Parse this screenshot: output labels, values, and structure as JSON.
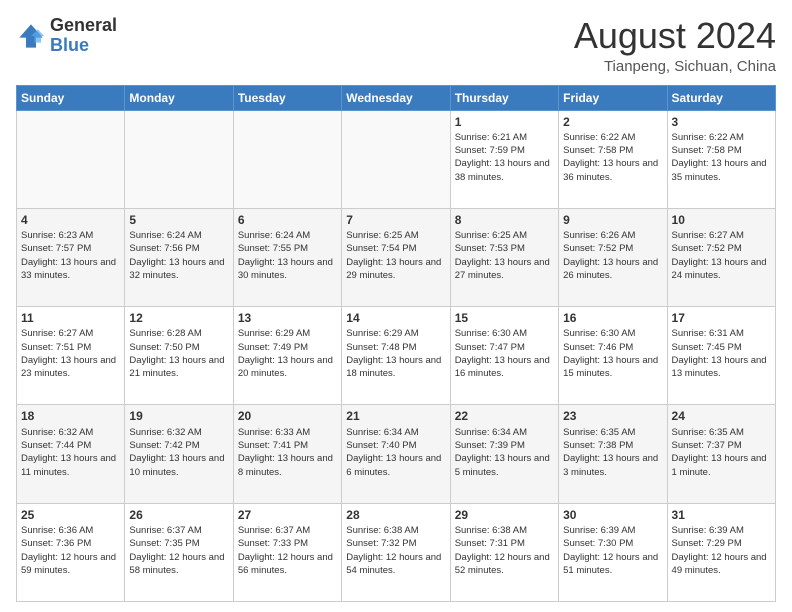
{
  "logo": {
    "general": "General",
    "blue": "Blue"
  },
  "header": {
    "month": "August 2024",
    "location": "Tianpeng, Sichuan, China"
  },
  "days_of_week": [
    "Sunday",
    "Monday",
    "Tuesday",
    "Wednesday",
    "Thursday",
    "Friday",
    "Saturday"
  ],
  "weeks": [
    [
      {
        "day": "",
        "info": ""
      },
      {
        "day": "",
        "info": ""
      },
      {
        "day": "",
        "info": ""
      },
      {
        "day": "",
        "info": ""
      },
      {
        "day": "1",
        "info": "Sunrise: 6:21 AM\nSunset: 7:59 PM\nDaylight: 13 hours\nand 38 minutes."
      },
      {
        "day": "2",
        "info": "Sunrise: 6:22 AM\nSunset: 7:58 PM\nDaylight: 13 hours\nand 36 minutes."
      },
      {
        "day": "3",
        "info": "Sunrise: 6:22 AM\nSunset: 7:58 PM\nDaylight: 13 hours\nand 35 minutes."
      }
    ],
    [
      {
        "day": "4",
        "info": "Sunrise: 6:23 AM\nSunset: 7:57 PM\nDaylight: 13 hours\nand 33 minutes."
      },
      {
        "day": "5",
        "info": "Sunrise: 6:24 AM\nSunset: 7:56 PM\nDaylight: 13 hours\nand 32 minutes."
      },
      {
        "day": "6",
        "info": "Sunrise: 6:24 AM\nSunset: 7:55 PM\nDaylight: 13 hours\nand 30 minutes."
      },
      {
        "day": "7",
        "info": "Sunrise: 6:25 AM\nSunset: 7:54 PM\nDaylight: 13 hours\nand 29 minutes."
      },
      {
        "day": "8",
        "info": "Sunrise: 6:25 AM\nSunset: 7:53 PM\nDaylight: 13 hours\nand 27 minutes."
      },
      {
        "day": "9",
        "info": "Sunrise: 6:26 AM\nSunset: 7:52 PM\nDaylight: 13 hours\nand 26 minutes."
      },
      {
        "day": "10",
        "info": "Sunrise: 6:27 AM\nSunset: 7:52 PM\nDaylight: 13 hours\nand 24 minutes."
      }
    ],
    [
      {
        "day": "11",
        "info": "Sunrise: 6:27 AM\nSunset: 7:51 PM\nDaylight: 13 hours\nand 23 minutes."
      },
      {
        "day": "12",
        "info": "Sunrise: 6:28 AM\nSunset: 7:50 PM\nDaylight: 13 hours\nand 21 minutes."
      },
      {
        "day": "13",
        "info": "Sunrise: 6:29 AM\nSunset: 7:49 PM\nDaylight: 13 hours\nand 20 minutes."
      },
      {
        "day": "14",
        "info": "Sunrise: 6:29 AM\nSunset: 7:48 PM\nDaylight: 13 hours\nand 18 minutes."
      },
      {
        "day": "15",
        "info": "Sunrise: 6:30 AM\nSunset: 7:47 PM\nDaylight: 13 hours\nand 16 minutes."
      },
      {
        "day": "16",
        "info": "Sunrise: 6:30 AM\nSunset: 7:46 PM\nDaylight: 13 hours\nand 15 minutes."
      },
      {
        "day": "17",
        "info": "Sunrise: 6:31 AM\nSunset: 7:45 PM\nDaylight: 13 hours\nand 13 minutes."
      }
    ],
    [
      {
        "day": "18",
        "info": "Sunrise: 6:32 AM\nSunset: 7:44 PM\nDaylight: 13 hours\nand 11 minutes."
      },
      {
        "day": "19",
        "info": "Sunrise: 6:32 AM\nSunset: 7:42 PM\nDaylight: 13 hours\nand 10 minutes."
      },
      {
        "day": "20",
        "info": "Sunrise: 6:33 AM\nSunset: 7:41 PM\nDaylight: 13 hours\nand 8 minutes."
      },
      {
        "day": "21",
        "info": "Sunrise: 6:34 AM\nSunset: 7:40 PM\nDaylight: 13 hours\nand 6 minutes."
      },
      {
        "day": "22",
        "info": "Sunrise: 6:34 AM\nSunset: 7:39 PM\nDaylight: 13 hours\nand 5 minutes."
      },
      {
        "day": "23",
        "info": "Sunrise: 6:35 AM\nSunset: 7:38 PM\nDaylight: 13 hours\nand 3 minutes."
      },
      {
        "day": "24",
        "info": "Sunrise: 6:35 AM\nSunset: 7:37 PM\nDaylight: 13 hours\nand 1 minute."
      }
    ],
    [
      {
        "day": "25",
        "info": "Sunrise: 6:36 AM\nSunset: 7:36 PM\nDaylight: 12 hours\nand 59 minutes."
      },
      {
        "day": "26",
        "info": "Sunrise: 6:37 AM\nSunset: 7:35 PM\nDaylight: 12 hours\nand 58 minutes."
      },
      {
        "day": "27",
        "info": "Sunrise: 6:37 AM\nSunset: 7:33 PM\nDaylight: 12 hours\nand 56 minutes."
      },
      {
        "day": "28",
        "info": "Sunrise: 6:38 AM\nSunset: 7:32 PM\nDaylight: 12 hours\nand 54 minutes."
      },
      {
        "day": "29",
        "info": "Sunrise: 6:38 AM\nSunset: 7:31 PM\nDaylight: 12 hours\nand 52 minutes."
      },
      {
        "day": "30",
        "info": "Sunrise: 6:39 AM\nSunset: 7:30 PM\nDaylight: 12 hours\nand 51 minutes."
      },
      {
        "day": "31",
        "info": "Sunrise: 6:39 AM\nSunset: 7:29 PM\nDaylight: 12 hours\nand 49 minutes."
      }
    ]
  ]
}
